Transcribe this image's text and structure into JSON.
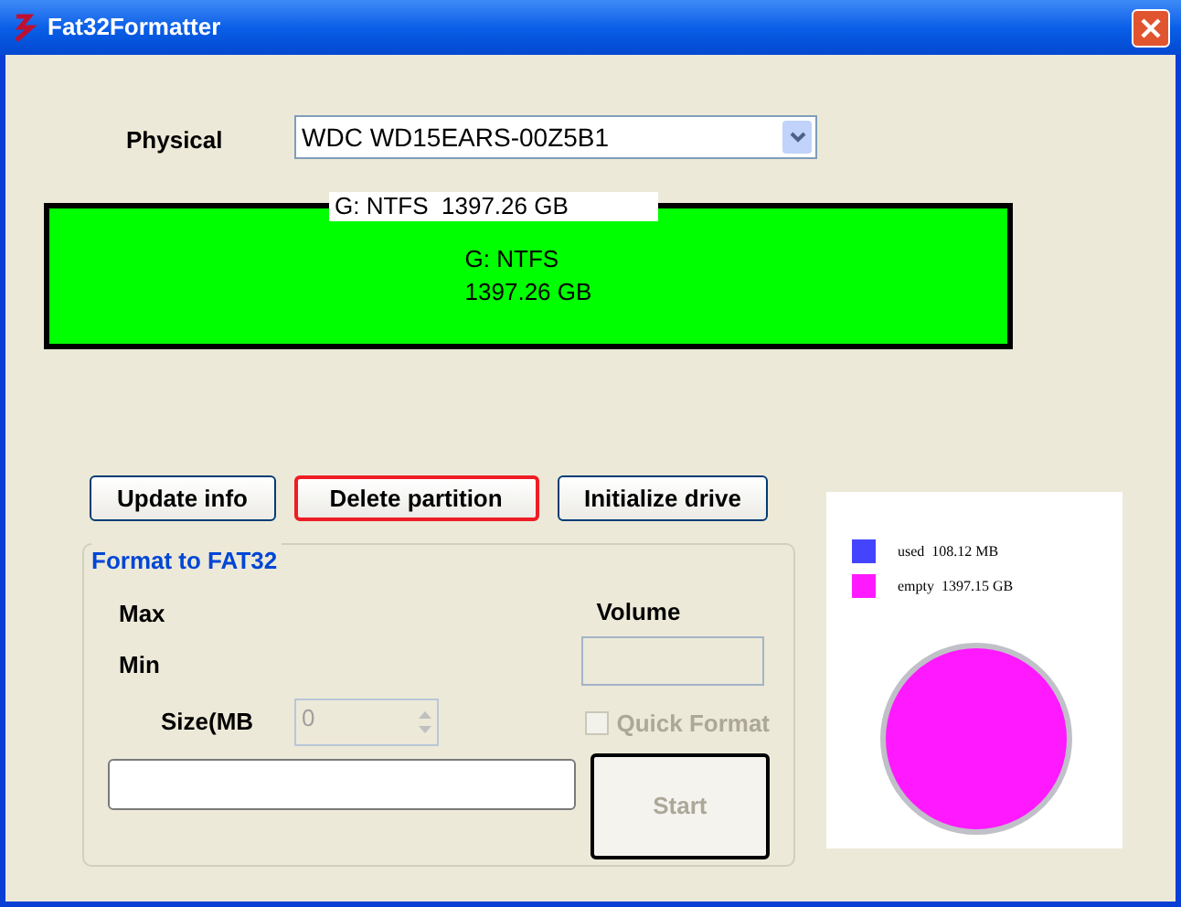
{
  "window": {
    "title": "Fat32Formatter"
  },
  "physical": {
    "label": "Physical",
    "value": "WDC WD15EARS-00Z5B1"
  },
  "partition_bar": {
    "tab_label": "G: NTFS  1397.26 GB",
    "lines": [
      "G: NTFS",
      "1397.26 GB"
    ]
  },
  "buttons": [
    {
      "label": "Update info",
      "focused": false
    },
    {
      "label": "Delete partition",
      "focused": true
    },
    {
      "label": "Initialize drive",
      "focused": false
    }
  ],
  "format_group": {
    "title": "Format to FAT32",
    "max_label": "Max",
    "min_label": "Min",
    "size_label": "Size(MB",
    "size_value": "0",
    "volume_label": "Volume",
    "quick_format": {
      "label": "Quick Format",
      "checked": false,
      "disabled": true
    },
    "start": {
      "label": "Start",
      "disabled": true
    }
  },
  "usage_legend": [
    {
      "label": "used",
      "value": "108.12 MB",
      "color": "#4444ff"
    },
    {
      "label": "empty",
      "value": "1397.15 GB",
      "color": "#ff19ff"
    }
  ]
}
